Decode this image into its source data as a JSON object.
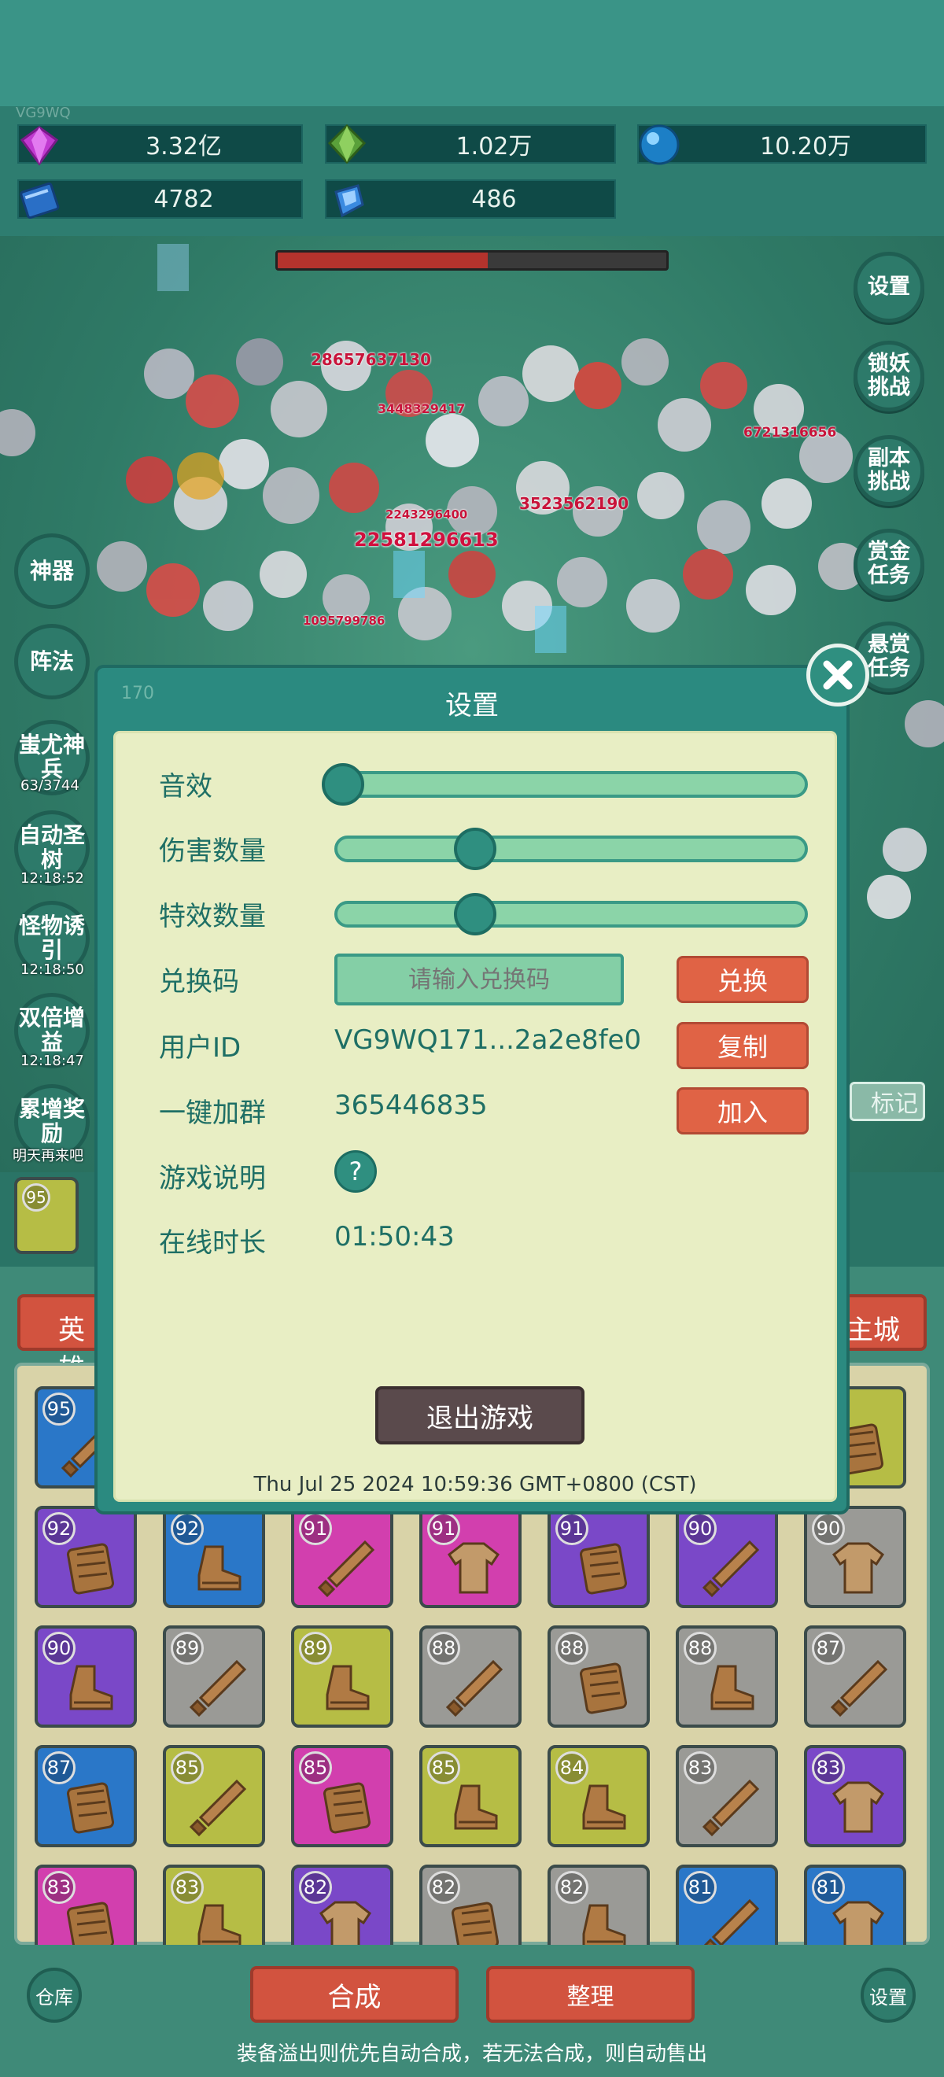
{
  "resources": [
    {
      "icon": "gem-purple-icon",
      "value": "3.32亿"
    },
    {
      "icon": "gem-green-icon",
      "value": "1.02万"
    },
    {
      "icon": "orb-blue-icon",
      "value": "10.20万"
    },
    {
      "icon": "book-icon",
      "value": "4782"
    },
    {
      "icon": "crystal-icon",
      "value": "486"
    }
  ],
  "user_id_faint": "VG9WQ",
  "boss_hp_fraction": 0.54,
  "right_menu": [
    "设置",
    "锁妖挑战",
    "副本挑战",
    "赏金任务",
    "悬赏任务"
  ],
  "left_menu": [
    {
      "label": "神器",
      "sub": ""
    },
    {
      "label": "阵法",
      "sub": ""
    },
    {
      "label": "蚩尤神兵",
      "sub": "63/3744"
    },
    {
      "label": "自动圣树",
      "sub": "12:18:52"
    },
    {
      "label": "怪物诱引",
      "sub": "12:18:50"
    },
    {
      "label": "双倍增益",
      "sub": "12:18:47"
    },
    {
      "label": "累增奖励",
      "sub": "明天再来吧"
    }
  ],
  "damage_numbers": [
    "28657637130",
    "22581296613",
    "3523562190",
    "6721316656",
    "3448329417",
    "2243296400",
    "1095799786"
  ],
  "side_tabs": {
    "left": "英雄",
    "right": "主城",
    "mark": "标记"
  },
  "settings": {
    "title": "设置",
    "dim_text": "170",
    "sound_label": "音效",
    "sound_level": 0.0,
    "damage_label": "伤害数量",
    "damage_level": 0.3,
    "effect_label": "特效数量",
    "effect_level": 0.3,
    "code_label": "兑换码",
    "code_placeholder": "请输入兑换码",
    "redeem_btn": "兑换",
    "uid_label": "用户ID",
    "uid_value": "VG9WQ171...2a2e8fe0",
    "copy_btn": "复制",
    "group_label": "一键加群",
    "group_value": "365446835",
    "join_btn": "加入",
    "guide_label": "游戏说明",
    "guide_icon": "?",
    "online_label": "在线时长",
    "online_value": "01:50:43",
    "exit_btn": "退出游戏",
    "datetime": "Thu Jul 25 2024 10:59:36 GMT+0800 (CST)"
  },
  "equipment_top_row": [
    {
      "level": "95",
      "color": "blue",
      "item": "sword"
    },
    {
      "level": "",
      "color": "yellow",
      "item": "armor"
    }
  ],
  "equipment_grid": [
    [
      {
        "level": "92",
        "color": "purple",
        "item": "armor"
      },
      {
        "level": "92",
        "color": "blue",
        "item": "boot"
      },
      {
        "level": "91",
        "color": "pink",
        "item": "sword"
      },
      {
        "level": "91",
        "color": "pink",
        "item": "shirt"
      },
      {
        "level": "91",
        "color": "purple",
        "item": "armor"
      },
      {
        "level": "90",
        "color": "purple",
        "item": "sword"
      },
      {
        "level": "90",
        "color": "grey",
        "item": "shirt"
      }
    ],
    [
      {
        "level": "90",
        "color": "purple",
        "item": "boot"
      },
      {
        "level": "89",
        "color": "grey",
        "item": "sword"
      },
      {
        "level": "89",
        "color": "yellow",
        "item": "boot"
      },
      {
        "level": "88",
        "color": "grey",
        "item": "sword"
      },
      {
        "level": "88",
        "color": "grey",
        "item": "armor"
      },
      {
        "level": "88",
        "color": "grey",
        "item": "boot"
      },
      {
        "level": "87",
        "color": "grey",
        "item": "sword"
      }
    ],
    [
      {
        "level": "87",
        "color": "blue",
        "item": "armor"
      },
      {
        "level": "85",
        "color": "yellow",
        "item": "sword"
      },
      {
        "level": "85",
        "color": "pink",
        "item": "armor"
      },
      {
        "level": "85",
        "color": "yellow",
        "item": "boot"
      },
      {
        "level": "84",
        "color": "yellow",
        "item": "boot"
      },
      {
        "level": "83",
        "color": "grey",
        "item": "sword"
      },
      {
        "level": "83",
        "color": "purple",
        "item": "shirt"
      }
    ],
    [
      {
        "level": "83",
        "color": "pink",
        "item": "armor"
      },
      {
        "level": "83",
        "color": "yellow",
        "item": "boot"
      },
      {
        "level": "82",
        "color": "purple",
        "item": "shirt"
      },
      {
        "level": "82",
        "color": "grey",
        "item": "armor"
      },
      {
        "level": "82",
        "color": "grey",
        "item": "boot"
      },
      {
        "level": "81",
        "color": "blue",
        "item": "sword"
      },
      {
        "level": "81",
        "color": "blue",
        "item": "shirt"
      }
    ]
  ],
  "bottom": {
    "warehouse": "仓库",
    "merge": "合成",
    "organize": "整理",
    "settings": "设置",
    "note": "装备溢出则优先自动合成，若无法合成，则自动售出"
  }
}
